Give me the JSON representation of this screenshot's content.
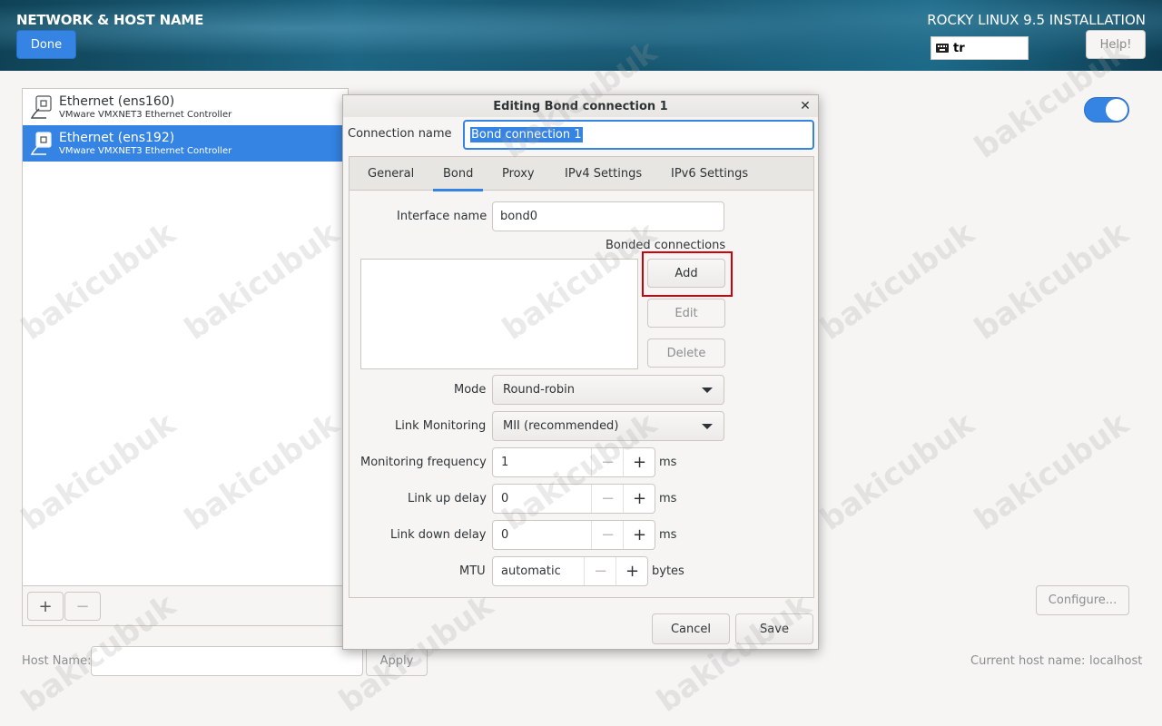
{
  "header": {
    "title": "NETWORK & HOST NAME",
    "done_label": "Done",
    "product": "ROCKY LINUX 9.5 INSTALLATION",
    "keyboard_layout": "tr",
    "help_label": "Help!"
  },
  "devices": [
    {
      "name": "Ethernet (ens160)",
      "desc": "VMware VMXNET3 Ethernet Controller",
      "selected": false
    },
    {
      "name": "Ethernet (ens192)",
      "desc": "VMware VMXNET3 Ethernet Controller",
      "selected": true
    }
  ],
  "device_footer": {
    "add_label": "+",
    "remove_label": "−"
  },
  "configure_label": "Configure...",
  "host": {
    "label": "Host Name:",
    "value": "",
    "apply_label": "Apply",
    "current_label": "Current host name:",
    "current_value": "localhost"
  },
  "dialog": {
    "title": "Editing Bond connection 1",
    "close_glyph": "✕",
    "connection_name_label": "Connection name",
    "connection_name_value": "Bond connection 1",
    "tabs": [
      {
        "label": "General",
        "active": false
      },
      {
        "label": "Bond",
        "active": true
      },
      {
        "label": "Proxy",
        "active": false
      },
      {
        "label": "IPv4 Settings",
        "active": false
      },
      {
        "label": "IPv6 Settings",
        "active": false
      }
    ],
    "bond": {
      "interface_name_label": "Interface name",
      "interface_name_value": "bond0",
      "bonded_connections_label": "Bonded connections",
      "add_label": "Add",
      "edit_label": "Edit",
      "delete_label": "Delete",
      "mode_label": "Mode",
      "mode_value": "Round-robin",
      "link_monitoring_label": "Link Monitoring",
      "link_monitoring_value": "MII (recommended)",
      "monitoring_frequency_label": "Monitoring frequency",
      "monitoring_frequency_value": "1",
      "link_up_delay_label": "Link up delay",
      "link_up_delay_value": "0",
      "link_down_delay_label": "Link down delay",
      "link_down_delay_value": "0",
      "mtu_label": "MTU",
      "mtu_value": "automatic",
      "unit_ms": "ms",
      "unit_bytes": "bytes",
      "minus_glyph": "−",
      "plus_glyph": "+"
    },
    "cancel_label": "Cancel",
    "save_label": "Save"
  },
  "watermark": "bakicubuk",
  "colors": {
    "accent": "#3584e4",
    "highlight": "#d0000a"
  }
}
